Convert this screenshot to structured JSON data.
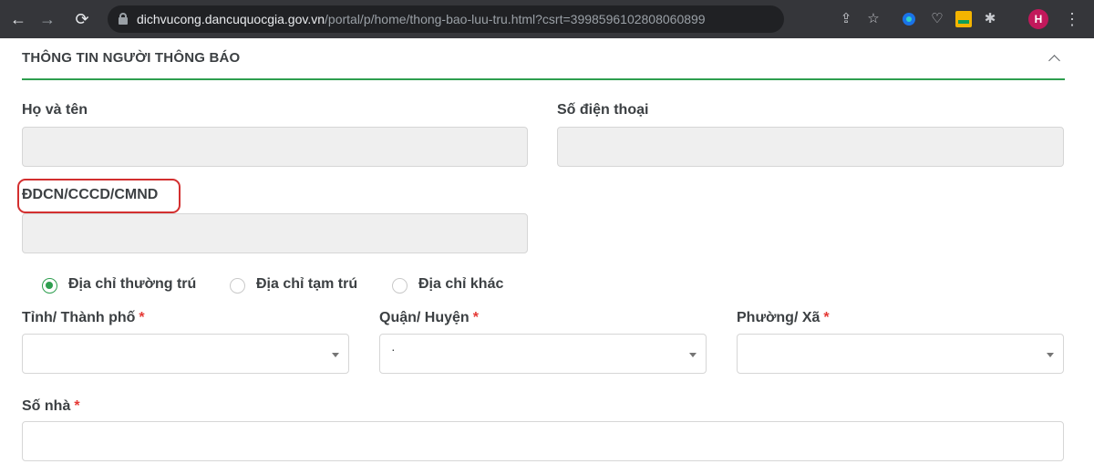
{
  "browser": {
    "url_host": "dichvucong.dancuquocgia.gov.vn",
    "url_path": "/portal/p/home/thong-bao-luu-tru.html?csrt=3998596102808060899",
    "profile_initial": "H"
  },
  "section": {
    "title": "THÔNG TIN NGƯỜI THÔNG BÁO"
  },
  "form": {
    "full_name": {
      "label": "Họ và tên",
      "value": ""
    },
    "phone": {
      "label": "Số điện thoại",
      "value": ""
    },
    "id_number": {
      "label": "ĐDCN/CCCD/CMND",
      "value": ""
    },
    "address_type": {
      "options": [
        {
          "label": "Địa chỉ thường trú",
          "checked": true
        },
        {
          "label": "Địa chỉ tạm trú",
          "checked": false
        },
        {
          "label": "Địa chỉ khác",
          "checked": false
        }
      ]
    },
    "province": {
      "label": "Tỉnh/ Thành phố",
      "required_mark": "*",
      "value": ""
    },
    "district": {
      "label": "Quận/ Huyện",
      "required_mark": "*",
      "value": "·"
    },
    "ward": {
      "label": "Phường/ Xã",
      "required_mark": "*",
      "value": ""
    },
    "house_number": {
      "label": "Số nhà",
      "required_mark": "*",
      "value": ""
    }
  },
  "colors": {
    "accent_green": "#2e9e4f",
    "required_red": "#e53935",
    "highlight_red": "#d32f2f",
    "disabled_bg": "#efefef"
  },
  "icons": {
    "back": "arrow-left-icon",
    "forward": "arrow-right-icon",
    "reload": "reload-icon",
    "lock": "lock-icon",
    "share": "share-icon",
    "bookmark": "star-icon",
    "pocket": "pocket-icon",
    "extensions": "puzzle-icon",
    "menu": "kebab-menu-icon",
    "collapse": "chevron-up-icon",
    "dropdown": "caret-down-icon"
  }
}
